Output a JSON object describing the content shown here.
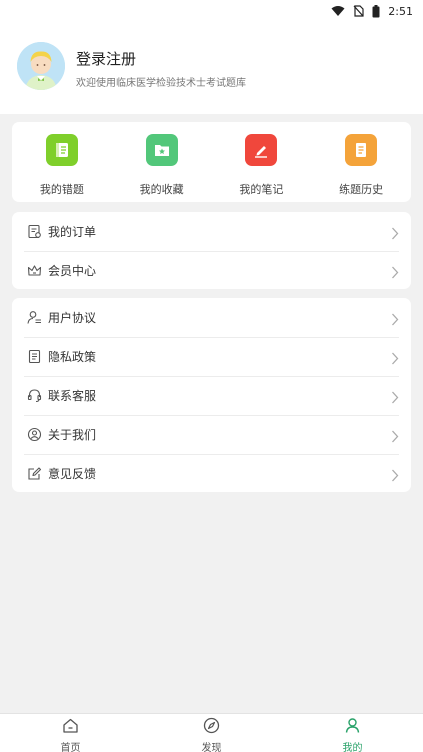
{
  "status_bar": {
    "time": "2:51",
    "icons": [
      "wifi-icon",
      "no-sim-icon",
      "battery-icon"
    ]
  },
  "profile": {
    "title": "登录注册",
    "subtitle": "欢迎使用临床医学检验技术士考试题库",
    "avatar_icon": "avatar-icon"
  },
  "quick_actions": [
    {
      "label": "我的错题",
      "icon": "mistakes-book-icon",
      "color": "#7fcf2b"
    },
    {
      "label": "我的收藏",
      "icon": "favorites-folder-icon",
      "color": "#52c77a"
    },
    {
      "label": "我的笔记",
      "icon": "notes-pencil-icon",
      "color": "#f0473c"
    },
    {
      "label": "练题历史",
      "icon": "history-document-icon",
      "color": "#f4a33a"
    }
  ],
  "orders_menu": [
    {
      "label": "我的订单",
      "icon": "order-icon"
    },
    {
      "label": "会员中心",
      "icon": "crown-icon"
    }
  ],
  "settings_menu": [
    {
      "label": "用户协议",
      "icon": "user-agreement-icon"
    },
    {
      "label": "隐私政策",
      "icon": "privacy-document-icon"
    },
    {
      "label": "联系客服",
      "icon": "headset-icon"
    },
    {
      "label": "关于我们",
      "icon": "about-user-icon"
    },
    {
      "label": "意见反馈",
      "icon": "feedback-edit-icon"
    }
  ],
  "tabbar": [
    {
      "label": "首页",
      "icon": "home-icon",
      "active": false
    },
    {
      "label": "发现",
      "icon": "compass-icon",
      "active": false
    },
    {
      "label": "我的",
      "icon": "profile-icon",
      "active": true
    }
  ],
  "colors": {
    "accent": "#2aa26a",
    "background": "#f1f1f1"
  }
}
